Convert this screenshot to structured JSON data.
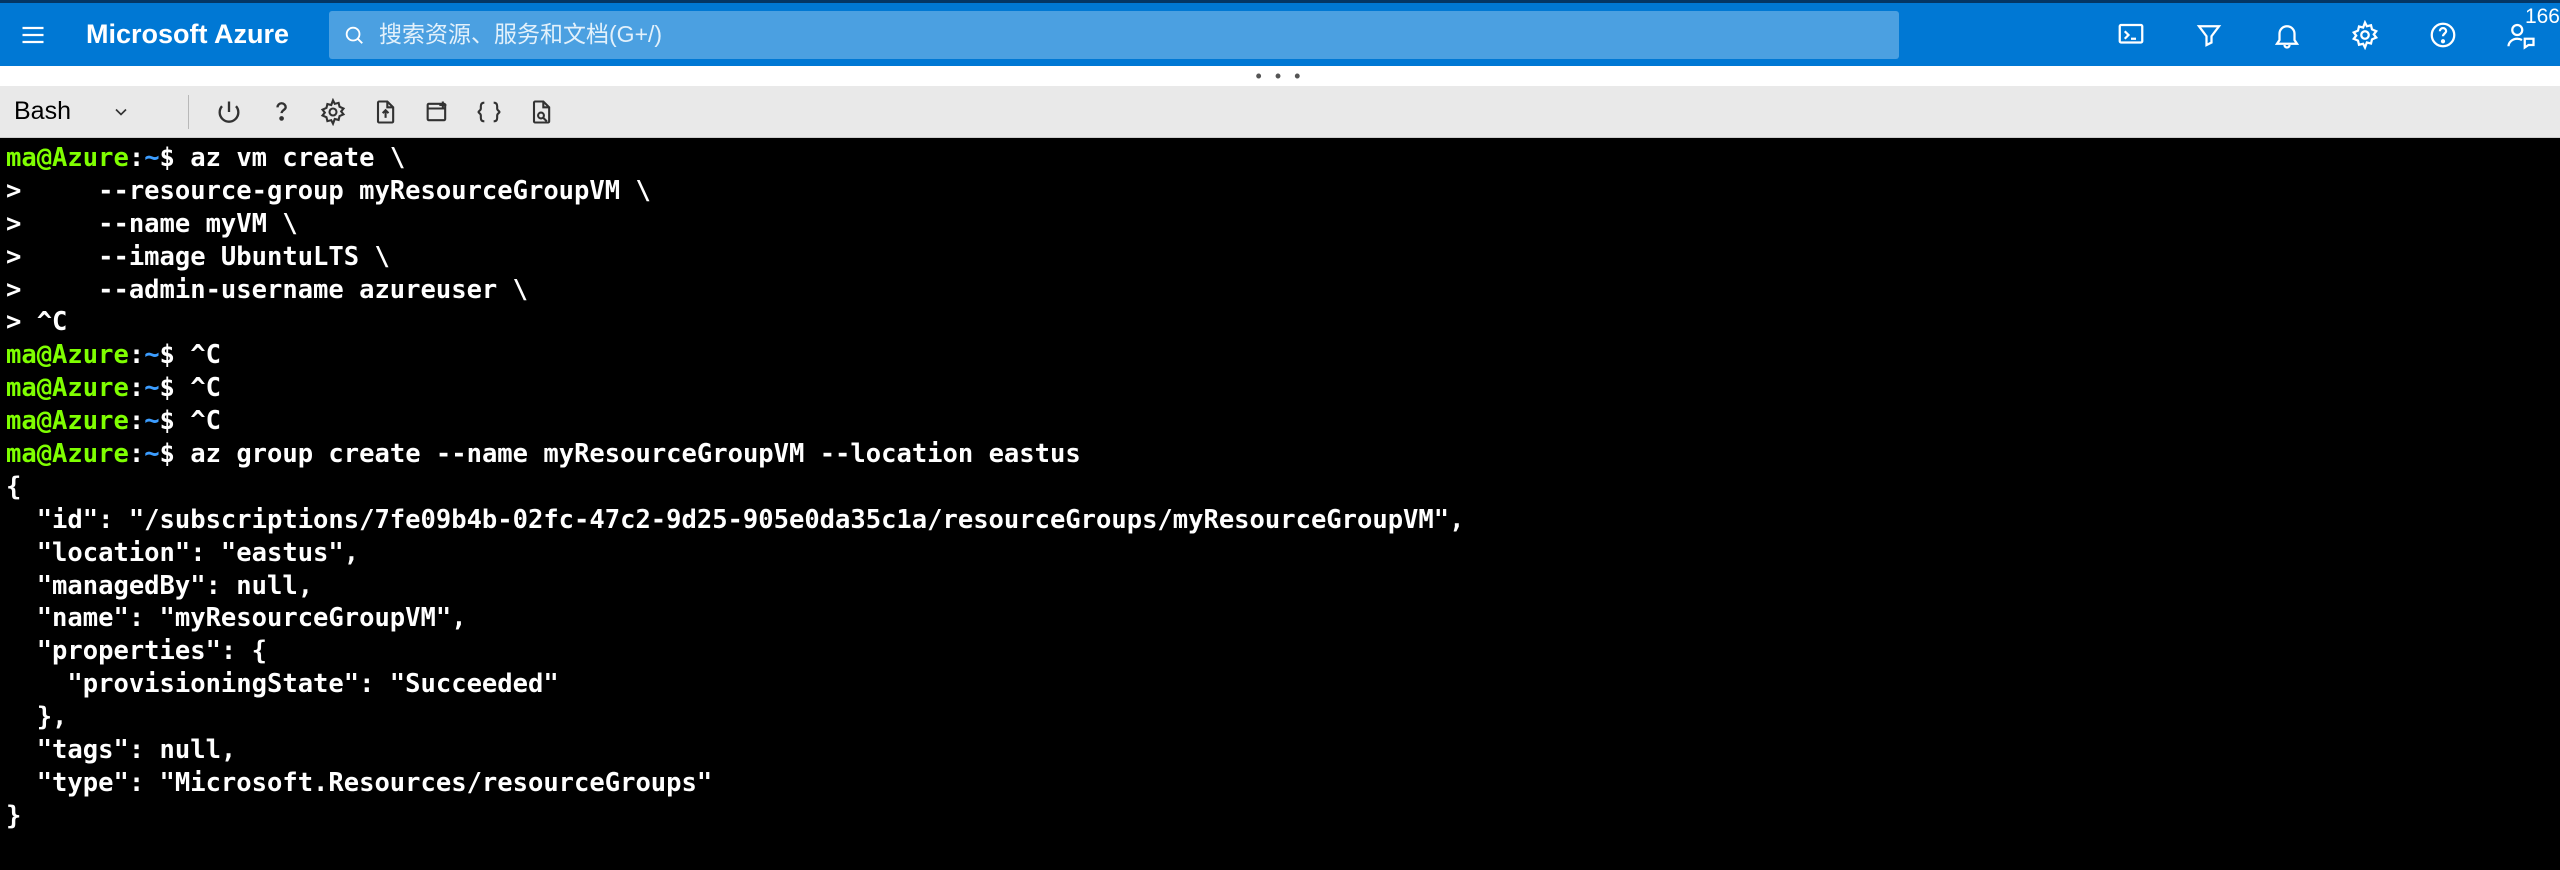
{
  "header": {
    "brand": "Microsoft Azure",
    "search_placeholder": "搜索资源、服务和文档(G+/)",
    "badge": "166"
  },
  "splitter": "• • •",
  "shell_toolbar": {
    "shell_name": "Bash"
  },
  "terminal": {
    "prompt_user": "ma@Azure",
    "prompt_sep1": ":",
    "prompt_path": "~",
    "prompt_dollar": "$ ",
    "lines": [
      {
        "kind": "cmd",
        "text": "az vm create \\"
      },
      {
        "kind": "cont",
        "text": ">     --resource-group myResourceGroupVM \\"
      },
      {
        "kind": "cont",
        "text": ">     --name myVM \\"
      },
      {
        "kind": "cont",
        "text": ">     --image UbuntuLTS \\"
      },
      {
        "kind": "cont",
        "text": ">     --admin-username azureuser \\"
      },
      {
        "kind": "cont",
        "text": "> ^C"
      },
      {
        "kind": "cmd",
        "text": "^C"
      },
      {
        "kind": "cmd",
        "text": "^C"
      },
      {
        "kind": "cmd",
        "text": "^C"
      },
      {
        "kind": "cmd",
        "text": "az group create --name myResourceGroupVM --location eastus"
      },
      {
        "kind": "out",
        "text": "{"
      },
      {
        "kind": "out",
        "text": "  \"id\": \"/subscriptions/7fe09b4b-02fc-47c2-9d25-905e0da35c1a/resourceGroups/myResourceGroupVM\","
      },
      {
        "kind": "out",
        "text": "  \"location\": \"eastus\","
      },
      {
        "kind": "out",
        "text": "  \"managedBy\": null,"
      },
      {
        "kind": "out",
        "text": "  \"name\": \"myResourceGroupVM\","
      },
      {
        "kind": "out",
        "text": "  \"properties\": {"
      },
      {
        "kind": "out",
        "text": "    \"provisioningState\": \"Succeeded\""
      },
      {
        "kind": "out",
        "text": "  },"
      },
      {
        "kind": "out",
        "text": "  \"tags\": null,"
      },
      {
        "kind": "out",
        "text": "  \"type\": \"Microsoft.Resources/resourceGroups\""
      },
      {
        "kind": "out",
        "text": "}"
      }
    ]
  }
}
